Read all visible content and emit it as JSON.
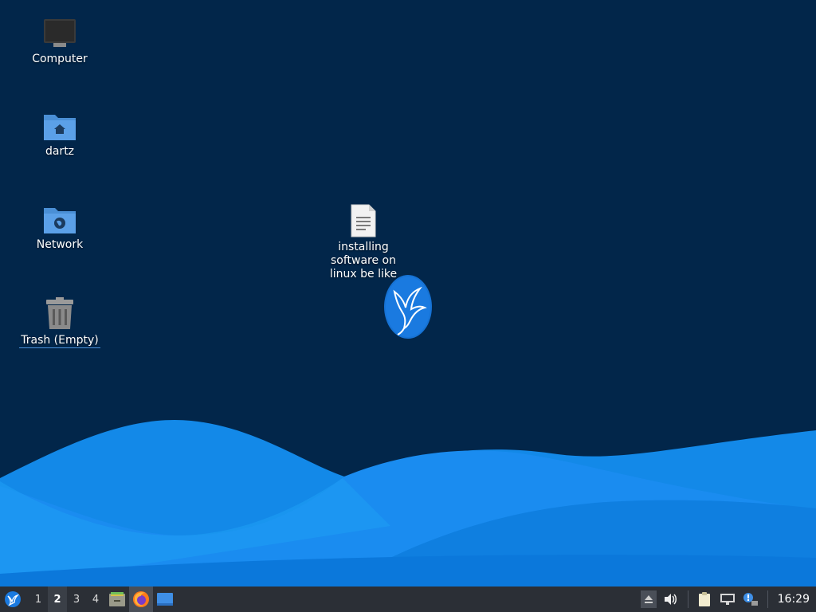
{
  "desktop": {
    "background": "#02264a",
    "icons": [
      {
        "label": "Computer",
        "icon": "computer-icon"
      },
      {
        "label": "dartz",
        "icon": "home-folder-icon"
      },
      {
        "label": "Network",
        "icon": "network-folder-icon"
      },
      {
        "label": "Trash (Empty)",
        "icon": "trash-icon"
      }
    ],
    "file": {
      "label": "installing software on linux be like",
      "icon": "text-file-icon"
    },
    "mascot": {
      "icon": "hummingbird-logo-icon"
    }
  },
  "panel": {
    "whisker_icon": "whisker-menu-icon",
    "workspaces": [
      "1",
      "2",
      "3",
      "4"
    ],
    "active_workspace": "2",
    "launchers": [
      {
        "name": "file-manager",
        "icon": "file-manager-icon"
      },
      {
        "name": "firefox",
        "icon": "firefox-icon"
      },
      {
        "name": "show-desktop",
        "icon": "desktop-icon"
      }
    ],
    "tray": [
      "eject-icon",
      "volume-icon",
      "clipboard-icon",
      "network-icon",
      "notification-icon"
    ],
    "clock": "16:29"
  }
}
